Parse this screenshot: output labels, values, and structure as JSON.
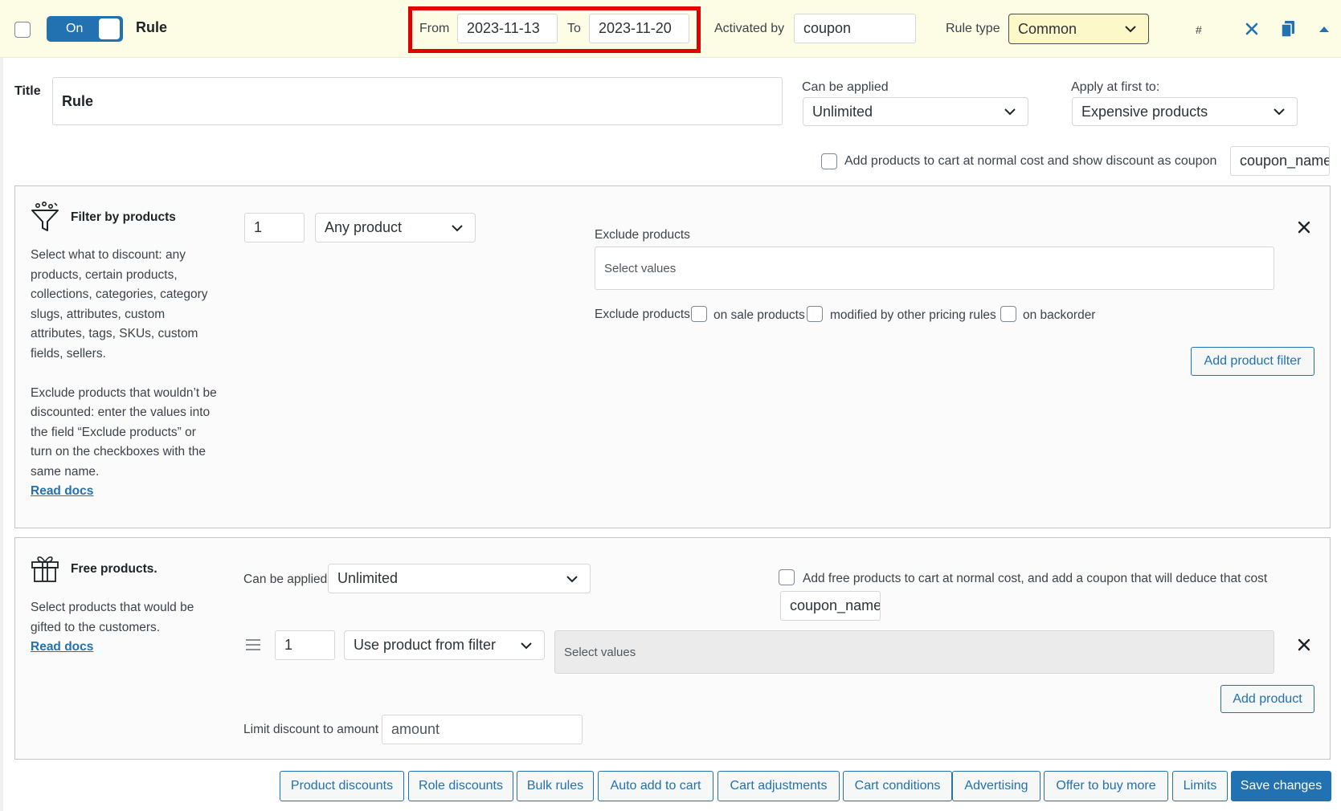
{
  "header": {
    "toggle_label": "On",
    "rule_name": "Rule",
    "from_label": "From",
    "from_value": "2023-11-13",
    "to_label": "To",
    "to_value": "2023-11-20",
    "activated_by_label": "Activated by",
    "activated_by_value": "coupon",
    "rule_type_label": "Rule type",
    "rule_type_value": "Common",
    "hash_label": "#",
    "colors": {
      "bar_bg": "#fdfde5",
      "highlight": "#e00000",
      "toggle": "#2271b1"
    }
  },
  "settings": {
    "title_label": "Title",
    "title_value": "Rule",
    "can_be_applied_label": "Can be applied",
    "can_be_applied_value": "Unlimited",
    "apply_first_label": "Apply at first to:",
    "apply_first_value": "Expensive products",
    "add_to_cart_label": "Add products to cart at normal cost and show discount as coupon",
    "coupon_name_value": "coupon_name"
  },
  "filter": {
    "title": "Filter by products",
    "description_1": "Select what to discount: any products, certain products, collections, categories, category slugs, attributes, custom attributes, tags, SKUs, custom fields, sellers.",
    "description_2": "Exclude products that wouldn’t be discounted: enter the values into the field “Exclude products” or turn on the checkboxes with the same name.",
    "read_docs": "Read docs",
    "qty_value": "1",
    "product_type_value": "Any product",
    "exclude_label": "Exclude products",
    "exclude_placeholder": "Select values",
    "exclude_products_label": "Exclude products",
    "on_sale_label": "on sale products",
    "modified_label": "modified by other pricing rules",
    "backorder_label": "on backorder",
    "add_filter_button": "Add product filter"
  },
  "free_products": {
    "title": "Free products.",
    "description": "Select products that would be gifted to the customers.",
    "read_docs": "Read docs",
    "can_be_applied_label": "Can be applied",
    "can_be_applied_value": "Unlimited",
    "add_free_label": "Add free products to cart at normal cost, and add a coupon that will deduce that cost",
    "coupon_name_value": "coupon_name",
    "qty_value": "1",
    "source_value": "Use product from filter",
    "values_placeholder": "Select values",
    "add_product_button": "Add product",
    "limit_label": "Limit discount to amount",
    "limit_placeholder": "amount"
  },
  "footer_buttons": {
    "product_discounts": "Product discounts",
    "role_discounts": "Role discounts",
    "bulk_rules": "Bulk rules",
    "auto_add": "Auto add to cart",
    "cart_adjustments": "Cart adjustments",
    "cart_conditions": "Cart conditions",
    "advertising": "Advertising",
    "offer_buy_more": "Offer to buy more",
    "limits": "Limits",
    "save": "Save changes"
  },
  "icons": [
    "filter-icon",
    "gift-icon",
    "close-icon",
    "copy-icon",
    "collapse-arrow-icon",
    "chevron-down-icon",
    "drag-handle-icon"
  ]
}
